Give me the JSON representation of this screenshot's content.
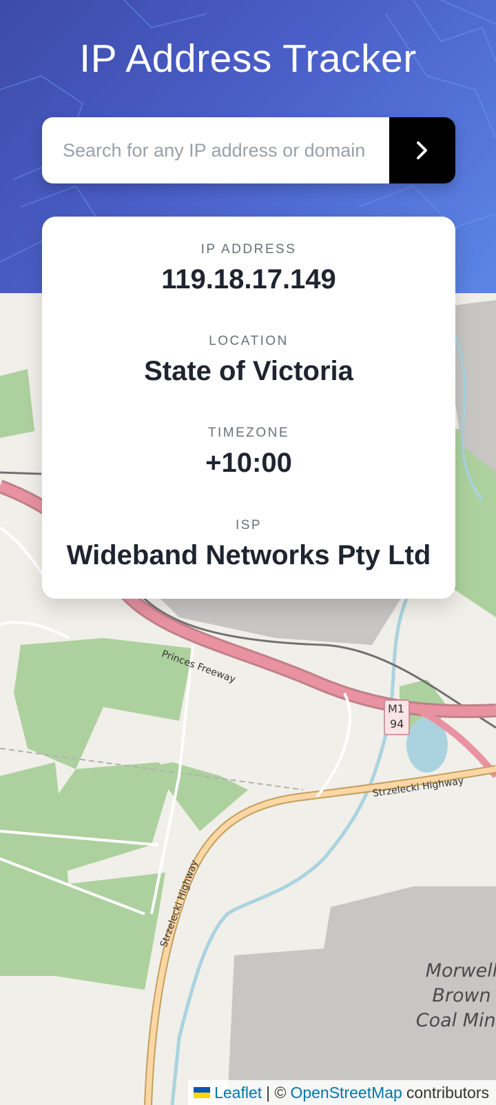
{
  "header": {
    "title": "IP Address Tracker"
  },
  "search": {
    "placeholder": "Search for any IP address or domain",
    "value": "",
    "submit_icon": "chevron-right-icon"
  },
  "info": {
    "ip": {
      "label": "IP ADDRESS",
      "value": "119.18.17.149"
    },
    "location": {
      "label": "LOCATION",
      "value": "State of Victoria"
    },
    "timezone": {
      "label": "TIMEZONE",
      "value": "+10:00"
    },
    "isp": {
      "label": "ISP",
      "value": "Wideband Networks Pty Ltd"
    }
  },
  "map": {
    "labels": {
      "princes_freeway": "Princes Freeway",
      "m1": "M1",
      "r94": "94",
      "strzelecki_highway_h": "Strzelecki Highway",
      "strzelecki_highway_v": "Strzelecki Highway",
      "mine_line1": "Morwell",
      "mine_line2": "Brown",
      "mine_line3": "Coal Mine"
    },
    "attribution": {
      "leaflet": "Leaflet",
      "separator": "| ©",
      "osm": "OpenStreetMap",
      "contributors": "contributors"
    }
  },
  "colors": {
    "header_start": "#3d4aa8",
    "header_end": "#5c86e6",
    "button": "#000000",
    "value_text": "#1f2430",
    "label_text": "#6b6f78"
  }
}
